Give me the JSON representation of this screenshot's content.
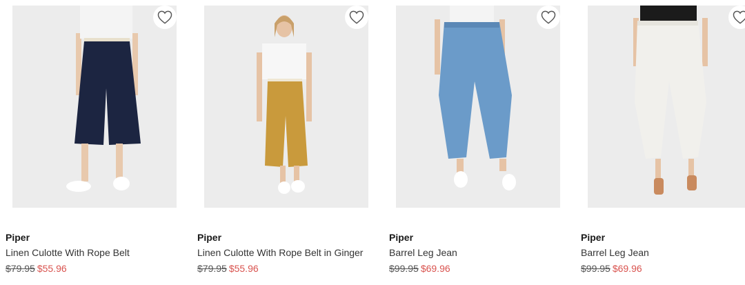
{
  "products": [
    {
      "brand": "Piper",
      "name": "Linen Culotte With Rope Belt",
      "was_price": "$79.95",
      "sale_price": "$55.96",
      "colors": {
        "top": "#f4f4f4",
        "pants": "#1c2541",
        "shoes": "#ffffff",
        "belt": "#e8e0cc"
      }
    },
    {
      "brand": "Piper",
      "name": "Linen Culotte With Rope Belt in Ginger",
      "was_price": "$79.95",
      "sale_price": "$55.96",
      "colors": {
        "top": "#f7f7f7",
        "pants": "#c99a3c",
        "shoes": "#ffffff",
        "belt": "#efe7d3"
      }
    },
    {
      "brand": "Piper",
      "name": "Barrel Leg Jean",
      "was_price": "$99.95",
      "sale_price": "$69.96",
      "colors": {
        "top": "#f4f4f4",
        "pants": "#6b9bc9",
        "shoes": "#ffffff",
        "belt": "#5b88b6"
      }
    },
    {
      "brand": "Piper",
      "name": "Barrel Leg Jean",
      "was_price": "$99.95",
      "sale_price": "$69.96",
      "colors": {
        "top": "#1b1b1b",
        "pants": "#f1f0ec",
        "shoes": "#c98a5e",
        "belt": "#e6e4dd"
      }
    }
  ],
  "icons": {
    "wishlist": "heart-outline-icon"
  },
  "accent": {
    "sale": "#d9534f"
  }
}
